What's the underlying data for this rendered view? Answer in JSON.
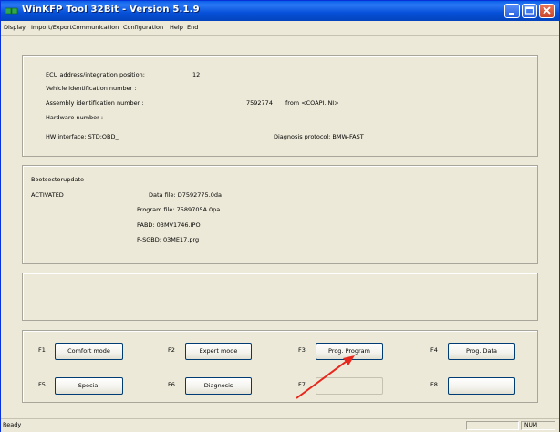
{
  "window": {
    "title": "WinKFP Tool 32Bit - Version 5.1.9"
  },
  "menu": [
    "Display",
    "Import/Export",
    "Communication",
    "Configuration",
    "Help",
    "End"
  ],
  "info": {
    "ecu_label": "ECU address/integration position:",
    "ecu_value": "12",
    "vin_label": "Vehicle identification number :",
    "assembly_label": "Assembly identification number :",
    "assembly_value": "7592774",
    "assembly_from": "from  <COAPI.INI>",
    "hardware_label": "Hardware number :",
    "hw_interface": "HW interface:  STD:OBD_",
    "diag_protocol": "Diagnosis protocol:  BMW-FAST"
  },
  "boot": {
    "title": "Bootsectorupdate",
    "status": "ACTIVATED",
    "data_file": "Data file:   D7592775.0da",
    "program_file": "Program file:  7589705A.0pa",
    "pabd": "PABD:      03MV1746.IPO",
    "psgbd": "P-SGBD:    03ME17.prg"
  },
  "buttons": {
    "f1": "F1",
    "f1_label": "Comfort mode",
    "f2": "F2",
    "f2_label": "Expert mode",
    "f3": "F3",
    "f3_label": "Prog. Program",
    "f4": "F4",
    "f4_label": "Prog. Data",
    "f5": "F5",
    "f5_label": "Special",
    "f6": "F6",
    "f6_label": "Diagnosis",
    "f7": "F7",
    "f7_label": "",
    "f8": "F8",
    "f8_label": ""
  },
  "status": {
    "text": "Ready",
    "num": "NUM"
  },
  "colors": {
    "title_bar": "#0650d8",
    "close_button": "#c9452a",
    "arrow": "#e8261c"
  }
}
